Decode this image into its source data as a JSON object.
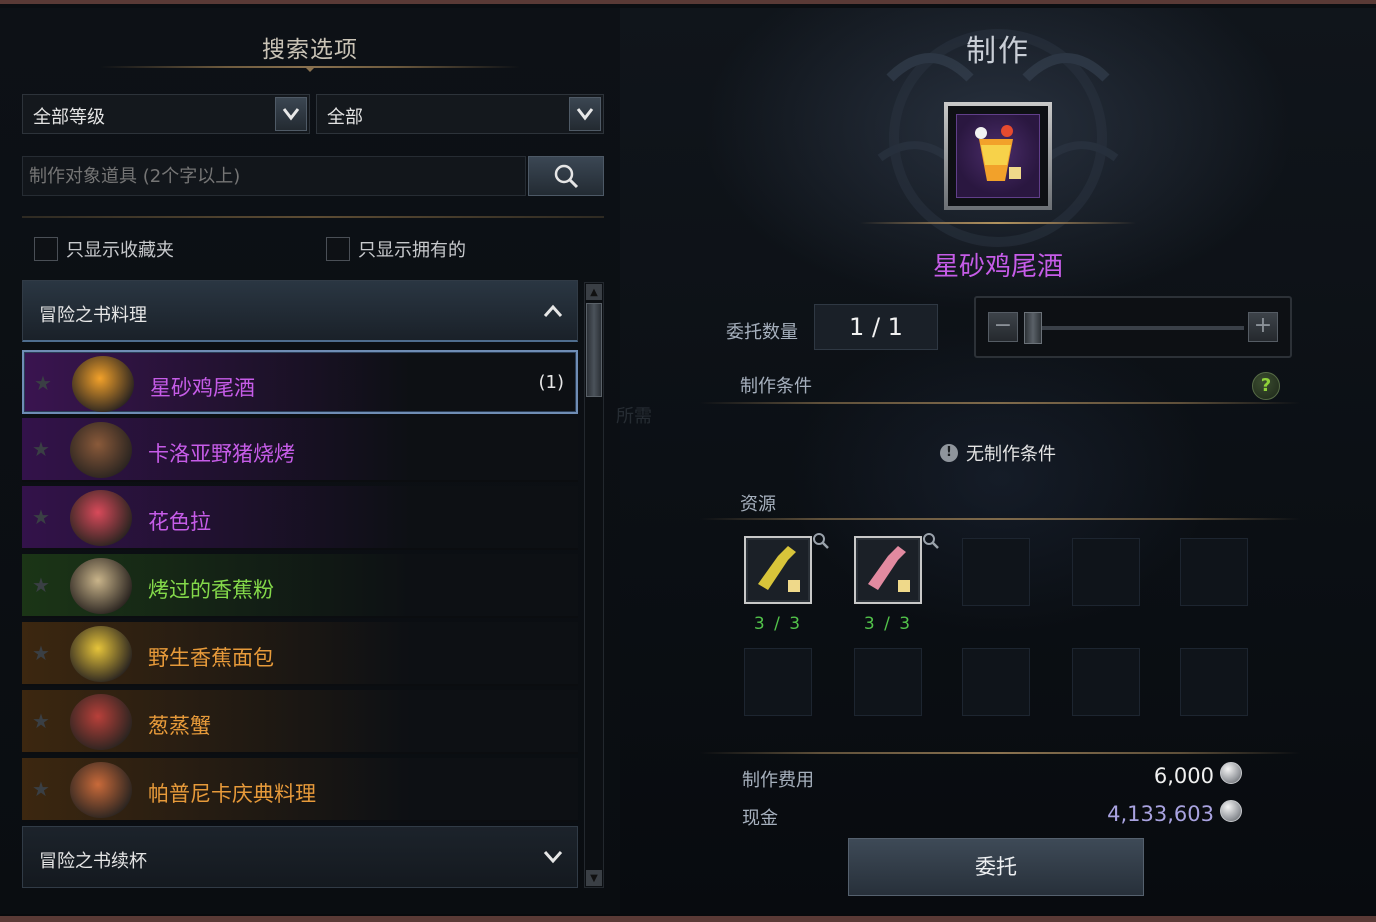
{
  "search": {
    "title": "搜索选项",
    "grade_dropdown": "全部等级",
    "type_dropdown": "全部",
    "placeholder": "制作对象道具 (2个字以上)",
    "only_favorites": "只显示收藏夹",
    "only_owned": "只显示拥有的"
  },
  "list": {
    "category_open": "冒险之书料理",
    "category_closed": "冒险之书续杯",
    "items": [
      {
        "name": "星砂鸡尾酒",
        "count": "(1)",
        "color": "#c65ce8",
        "bg": "#3a1450"
      },
      {
        "name": "卡洛亚野猪烧烤",
        "count": "",
        "color": "#c65ce8",
        "bg": "#33124a"
      },
      {
        "name": "花色拉",
        "count": "",
        "color": "#c65ce8",
        "bg": "#33124a"
      },
      {
        "name": "烤过的香蕉粉",
        "count": "",
        "color": "#84d94a",
        "bg": "#1b3516"
      },
      {
        "name": "野生香蕉面包",
        "count": "",
        "color": "#e79a3a",
        "bg": "#3c2710"
      },
      {
        "name": "葱蒸蟹",
        "count": "",
        "color": "#e79a3a",
        "bg": "#3c2710"
      },
      {
        "name": "帕普尼卡庆典料理",
        "count": "",
        "color": "#e79a3a",
        "bg": "#3c2710"
      }
    ]
  },
  "craft": {
    "title": "制作",
    "item_name": "星砂鸡尾酒",
    "qty_label": "委托数量",
    "qty_value": "1 / 1",
    "conditions_label": "制作条件",
    "no_conditions": "无制作条件",
    "resources_label": "资源",
    "resources": [
      {
        "count": "3 / 3",
        "icon": "yellow-bottle-icon"
      },
      {
        "count": "3 / 3",
        "icon": "pink-bottle-icon"
      }
    ],
    "cost_label": "制作费用",
    "cost_value": "6,000",
    "cash_label": "现金",
    "cash_value": "4,133,603",
    "commission_button": "委托",
    "faint_label": "所需"
  }
}
